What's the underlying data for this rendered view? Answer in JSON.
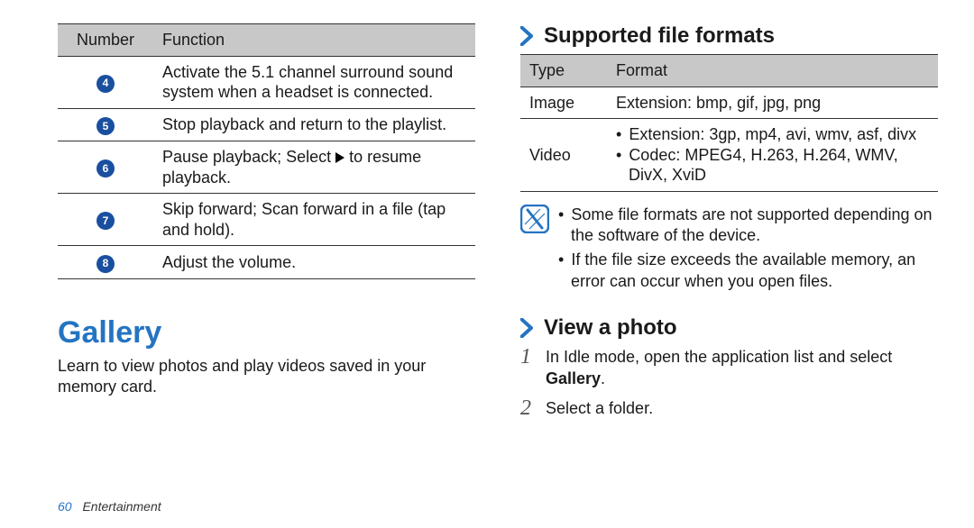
{
  "left_table": {
    "headers": [
      "Number",
      "Function"
    ],
    "rows": [
      {
        "num": "4",
        "func_plain": "Activate the 5.1 channel surround sound system when a headset is connected."
      },
      {
        "num": "5",
        "func_plain": "Stop playback and return to the playlist."
      },
      {
        "num": "6",
        "func_prefix": "Pause playback; Select ",
        "func_suffix": " to resume playback.",
        "has_play_glyph": true
      },
      {
        "num": "7",
        "func_plain": "Skip forward; Scan forward in a file (tap and hold)."
      },
      {
        "num": "8",
        "func_plain": "Adjust the volume."
      }
    ]
  },
  "gallery": {
    "title": "Gallery",
    "intro": "Learn to view photos and play videos saved in your memory card."
  },
  "formats_heading": "Supported file formats",
  "formats_table": {
    "headers": [
      "Type",
      "Format"
    ],
    "rows": [
      {
        "type": "Image",
        "format_plain": "Extension: bmp, gif, jpg, png"
      },
      {
        "type": "Video",
        "format_bullets": [
          "Extension: 3gp, mp4, avi, wmv, asf, divx",
          "Codec: MPEG4, H.263, H.264, WMV, DivX, XviD"
        ]
      }
    ]
  },
  "notes": [
    "Some file formats are not supported depending on the software of the device.",
    "If the file size exceeds the available memory, an error can occur when you open files."
  ],
  "view_heading": "View a photo",
  "steps": {
    "1_prefix": "In Idle mode, open the application list and select ",
    "1_bold": "Gallery",
    "1_suffix": ".",
    "2": "Select a folder."
  },
  "footer": {
    "page": "60",
    "section": "Entertainment"
  }
}
